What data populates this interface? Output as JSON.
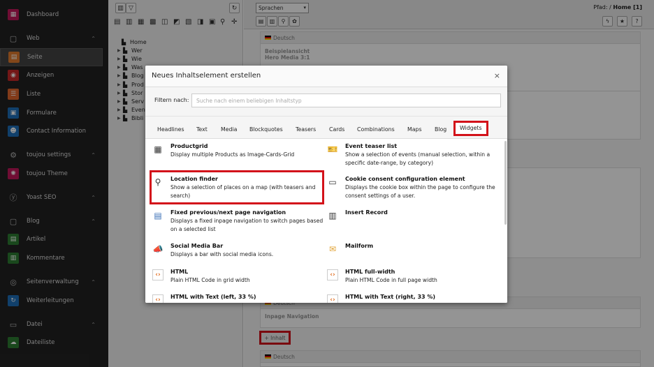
{
  "modmenu": {
    "items": [
      {
        "label": "Dashboard",
        "icon": "dashboard-icon",
        "color": "#c2185b",
        "glyph": "▦"
      },
      {
        "label": "Web",
        "icon": "web-icon",
        "group": true,
        "glyph": "▢"
      },
      {
        "label": "Seite",
        "icon": "page-icon",
        "color": "#e07a2e",
        "glyph": "▤",
        "active": true
      },
      {
        "label": "Anzeigen",
        "icon": "view-icon",
        "color": "#c62828",
        "glyph": "◉"
      },
      {
        "label": "Liste",
        "icon": "list-icon",
        "color": "#e0662e",
        "glyph": "☰"
      },
      {
        "label": "Formulare",
        "icon": "forms-icon",
        "color": "#1e6fb8",
        "glyph": "▣"
      },
      {
        "label": "Contact Information",
        "icon": "contact-icon",
        "color": "#1e6fb8",
        "glyph": "☻"
      },
      {
        "label": "toujou settings",
        "icon": "gear-icon",
        "group": true,
        "glyph": "⚙"
      },
      {
        "label": "toujou Theme",
        "icon": "fingerprint-icon",
        "color": "#c2185b",
        "glyph": "✺"
      },
      {
        "label": "Yoast SEO",
        "icon": "yoast-icon",
        "group": true,
        "glyph": "ⓨ"
      },
      {
        "label": "Blog",
        "icon": "blog-icon",
        "group": true,
        "glyph": "▢"
      },
      {
        "label": "Artikel",
        "icon": "article-icon",
        "color": "#2e7d32",
        "glyph": "▤"
      },
      {
        "label": "Kommentare",
        "icon": "comments-icon",
        "color": "#2e7d32",
        "glyph": "▥"
      },
      {
        "label": "Seitenverwaltung",
        "icon": "globe-icon",
        "group": true,
        "glyph": "◎"
      },
      {
        "label": "Weiterleitungen",
        "icon": "redirect-icon",
        "color": "#1e6fb8",
        "glyph": "↻"
      },
      {
        "label": "Datei",
        "icon": "file-icon",
        "group": true,
        "glyph": "▭"
      },
      {
        "label": "Dateiliste",
        "icon": "filelist-icon",
        "color": "#2e7d32",
        "glyph": "☁"
      }
    ]
  },
  "tree": {
    "nodes": [
      "Home",
      "Wer",
      "Wie",
      "Was",
      "Blog",
      "Prod",
      "Stor",
      "Serv",
      "Even",
      "Bibli"
    ]
  },
  "docbar": {
    "language": "Sprachen",
    "path_label": "Pfad: /",
    "path_page": "Home [1]"
  },
  "content": {
    "lang": "Deutsch",
    "text1": "Beispielansicht",
    "text2": "Hero Media 3:1",
    "inpage": "Inpage Navigation",
    "add": "+ Inhalt"
  },
  "modal": {
    "title": "Neues Inhaltselement erstellen",
    "close": "×",
    "filter_label": "Filtern nach:",
    "filter_placeholder": "Suche nach einem beliebigen Inhaltstyp",
    "tabs": [
      "Headlines",
      "Text",
      "Media",
      "Blockquotes",
      "Teasers",
      "Cards",
      "Combinations",
      "Maps",
      "Blog",
      "Widgets"
    ],
    "active_tab": "Widgets",
    "widgets": [
      {
        "title": "Productgrid",
        "desc": "Display multiple Products as Image-Cards-Grid",
        "icon": "grid-icon"
      },
      {
        "title": "Event teaser list",
        "desc": "Show a selection of events (manual selection, within a specific date-range, by category)",
        "icon": "ticket-icon"
      },
      {
        "title": "Location finder",
        "desc": "Show a selection of places on a map (with teasers and search)",
        "icon": "map-search-icon"
      },
      {
        "title": "Cookie consent configuration element",
        "desc": "Displays the cookie box within the page to configure the consent settings of a user.",
        "icon": "cookie-card-icon"
      },
      {
        "title": "Fixed previous/next page navigation",
        "desc": "Displays a fixed inpage navigation to switch pages based on a selected list",
        "icon": "page-nav-icon"
      },
      {
        "title": "Insert Record",
        "desc": "",
        "icon": "insert-record-icon"
      },
      {
        "title": "Social Media Bar",
        "desc": "Displays a bar with social media icons.",
        "icon": "megaphone-icon"
      },
      {
        "title": "Mailform",
        "desc": "",
        "icon": "mail-icon"
      },
      {
        "title": "HTML",
        "desc": "Plain HTML Code in grid width",
        "icon": "code-icon"
      },
      {
        "title": "HTML full-width",
        "desc": "Plain HTML Code in full page width",
        "icon": "code-icon"
      },
      {
        "title": "HTML with Text (left, 33 %)",
        "desc": "",
        "icon": "code-icon"
      },
      {
        "title": "HTML with Text (right, 33 %)",
        "desc": "",
        "icon": "code-icon"
      }
    ]
  }
}
